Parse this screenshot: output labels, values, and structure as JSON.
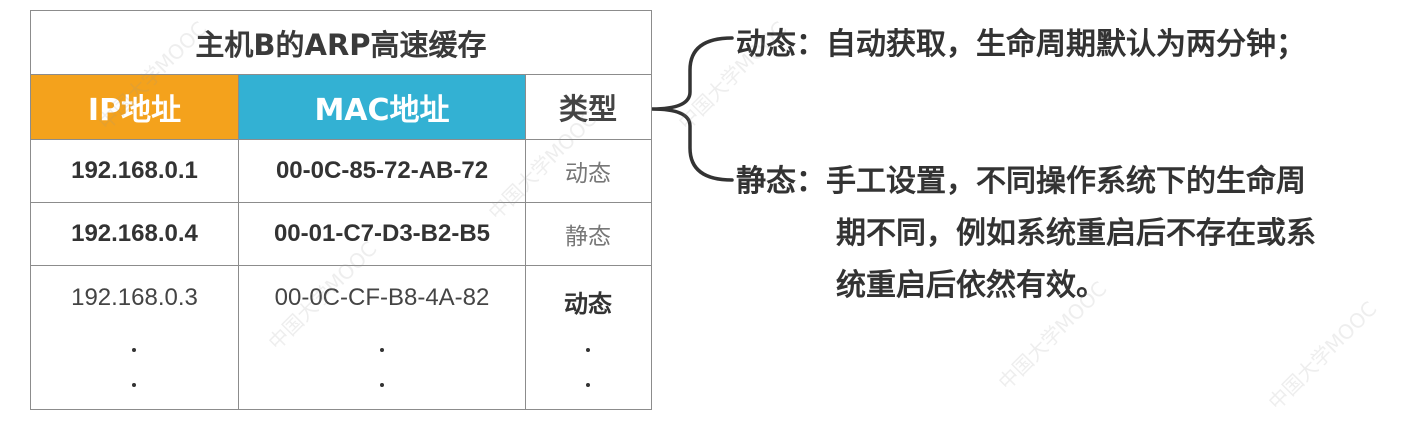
{
  "colors": {
    "ip_header": "#f4a21c",
    "mac_header": "#33b1d3"
  },
  "table": {
    "title": "主机B的ARP高速缓存",
    "headers": {
      "ip": "IP地址",
      "mac": "MAC地址",
      "type": "类型"
    },
    "rows": [
      {
        "ip": "192.168.0.1",
        "mac": "00-0C-85-72-AB-72",
        "type": "动态"
      },
      {
        "ip": "192.168.0.4",
        "mac": "00-01-C7-D3-B2-B5",
        "type": "静态"
      },
      {
        "ip": "192.168.0.3",
        "mac": "00-0C-CF-B8-4A-82",
        "type": "动态"
      }
    ],
    "ellipsis_glyph": "vertical-dots"
  },
  "notes": {
    "dynamic": "动态：自动获取，生命周期默认为两分钟；",
    "static_line1": "静态：手工设置，不同操作系统下的生命周",
    "static_line2": "期不同，例如系统重启后不存在或系",
    "static_line3": "统重启后依然有效。"
  },
  "icons": {
    "brace": "left-curly-brace-icon"
  },
  "watermark": "中国大学MOOC"
}
